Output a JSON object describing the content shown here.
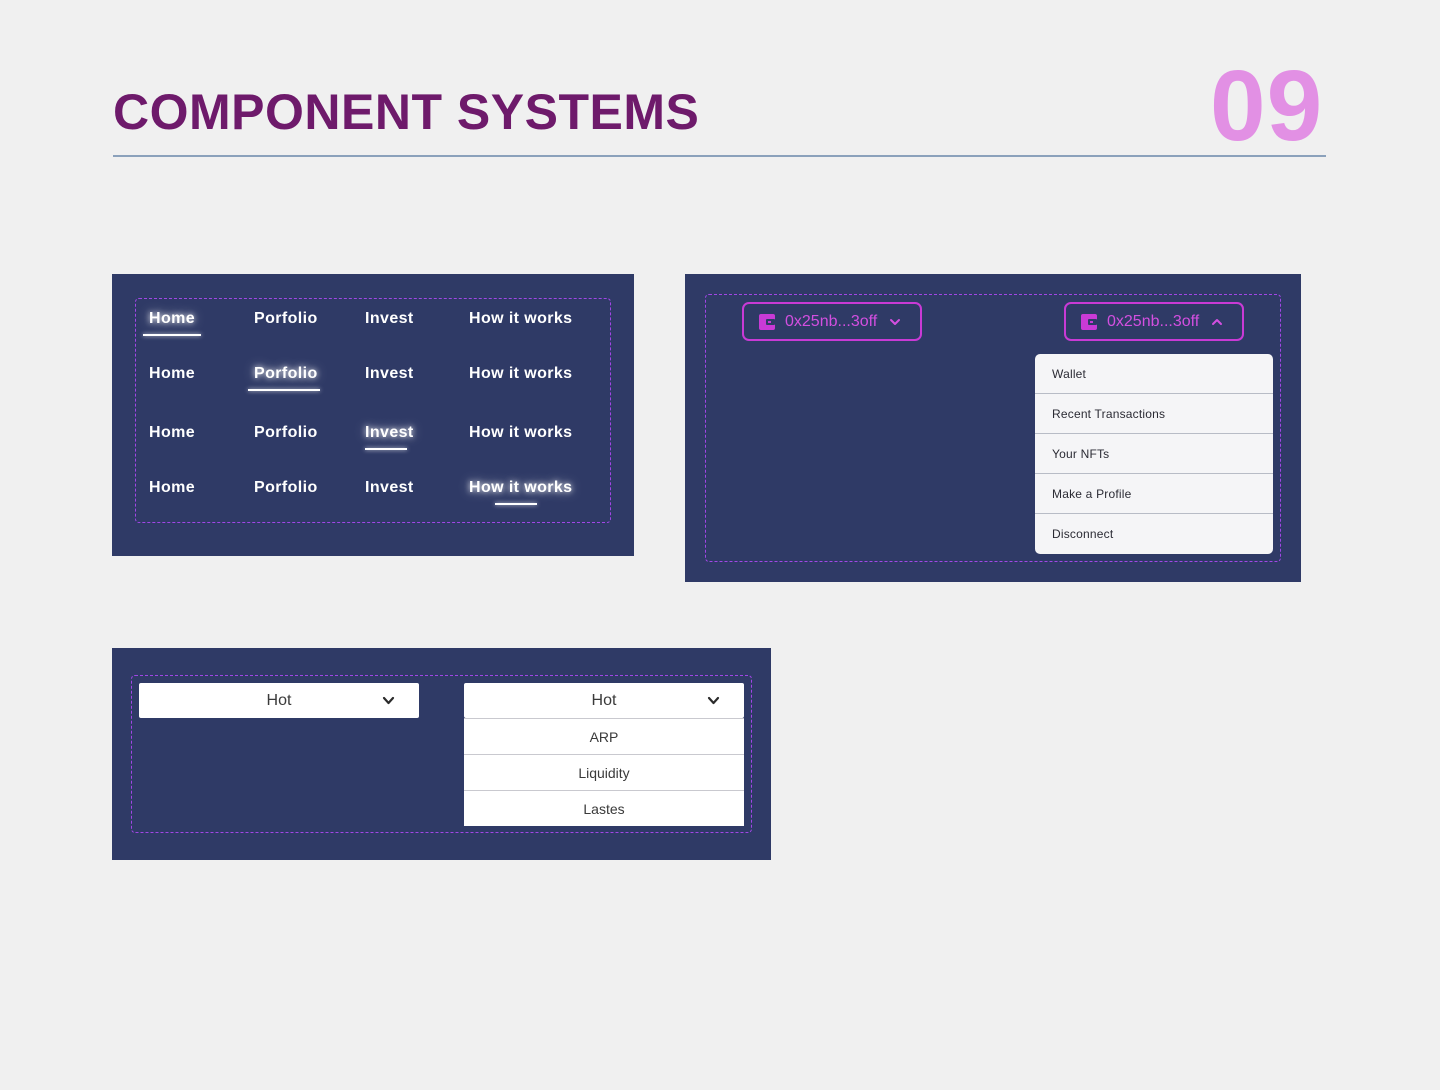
{
  "header": {
    "title": "COMPONENT SYSTEMS",
    "number": "09"
  },
  "nav_panel": {
    "rows": [
      {
        "items": [
          "Home",
          "Porfolio",
          "Invest",
          "How it works"
        ],
        "active": 0
      },
      {
        "items": [
          "Home",
          "Porfolio",
          "Invest",
          "How it works"
        ],
        "active": 1
      },
      {
        "items": [
          "Home",
          "Porfolio",
          "Invest",
          "How it works"
        ],
        "active": 2
      },
      {
        "items": [
          "Home",
          "Porfolio",
          "Invest",
          "How it works"
        ],
        "active": 3
      }
    ]
  },
  "wallet_panel": {
    "collapsed_button": {
      "address": "0x25nb...3off",
      "icon": "wallet-icon",
      "chevron": "chevron-down-icon"
    },
    "expanded_button": {
      "address": "0x25nb...3off",
      "icon": "wallet-icon",
      "chevron": "chevron-up-icon"
    },
    "menu": [
      "Wallet",
      "Recent Transactions",
      "Your NFTs",
      "Make a Profile",
      "Disconnect"
    ]
  },
  "sort_panel": {
    "closed_select": {
      "value": "Hot",
      "chevron": "chevron-down-icon"
    },
    "open_select": {
      "value": "Hot",
      "chevron": "chevron-down-icon"
    },
    "options": [
      "ARP",
      "Liquidity",
      "Lastes"
    ]
  },
  "colors": {
    "background": "#f0f0f0",
    "title": "#6e1a6b",
    "number": "#e290e4",
    "panel": "#2f3a66",
    "dashed_border": "#a146e6",
    "wallet_accent": "#d34fe0"
  }
}
